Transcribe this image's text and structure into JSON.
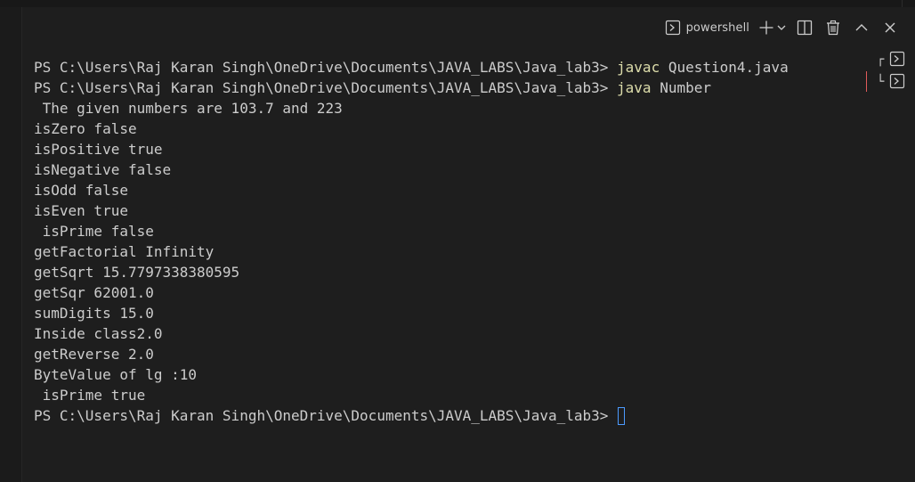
{
  "toolbar": {
    "terminal_name": "powershell",
    "icons": [
      "terminal-icon",
      "plus-icon",
      "chevron-down-icon",
      "split-icon",
      "trash-icon",
      "chevron-up-icon",
      "close-icon"
    ]
  },
  "terminal": {
    "lines": [
      {
        "prompt": "PS C:\\Users\\Raj Karan Singh\\OneDrive\\Documents\\JAVA_LABS\\Java_lab3> ",
        "cmd": "javac",
        "args": " Question4.java"
      },
      {
        "prompt": "PS C:\\Users\\Raj Karan Singh\\OneDrive\\Documents\\JAVA_LABS\\Java_lab3> ",
        "cmd": "java",
        "args": " Number"
      },
      {
        "text": " The given numbers are 103.7 and 223"
      },
      {
        "text": "isZero false"
      },
      {
        "text": "isPositive true"
      },
      {
        "text": "isNegative false"
      },
      {
        "text": "isOdd false"
      },
      {
        "text": "isEven true"
      },
      {
        "text": " isPrime false"
      },
      {
        "text": "getFactorial Infinity"
      },
      {
        "text": "getSqrt 15.7797338380595"
      },
      {
        "text": "getSqr 62001.0"
      },
      {
        "text": "sumDigits 15.0"
      },
      {
        "text": "Inside class2.0"
      },
      {
        "text": "getReverse 2.0"
      },
      {
        "text": "ByteValue of lg :10"
      },
      {
        "text": " isPrime true"
      },
      {
        "prompt": "PS C:\\Users\\Raj Karan Singh\\OneDrive\\Documents\\JAVA_LABS\\Java_lab3> ",
        "cursor": true
      }
    ]
  },
  "term_tabs": [
    {
      "glyph": "┌",
      "icon": "terminal-icon",
      "active": false
    },
    {
      "glyph": "└",
      "icon": "terminal-icon",
      "active": true
    }
  ],
  "colors": {
    "background": "#1e1e1e",
    "text": "#cccccc",
    "command": "#dcdcaa",
    "cursor": "#4c9bff",
    "active_tab_marker": "#e05a5a"
  }
}
